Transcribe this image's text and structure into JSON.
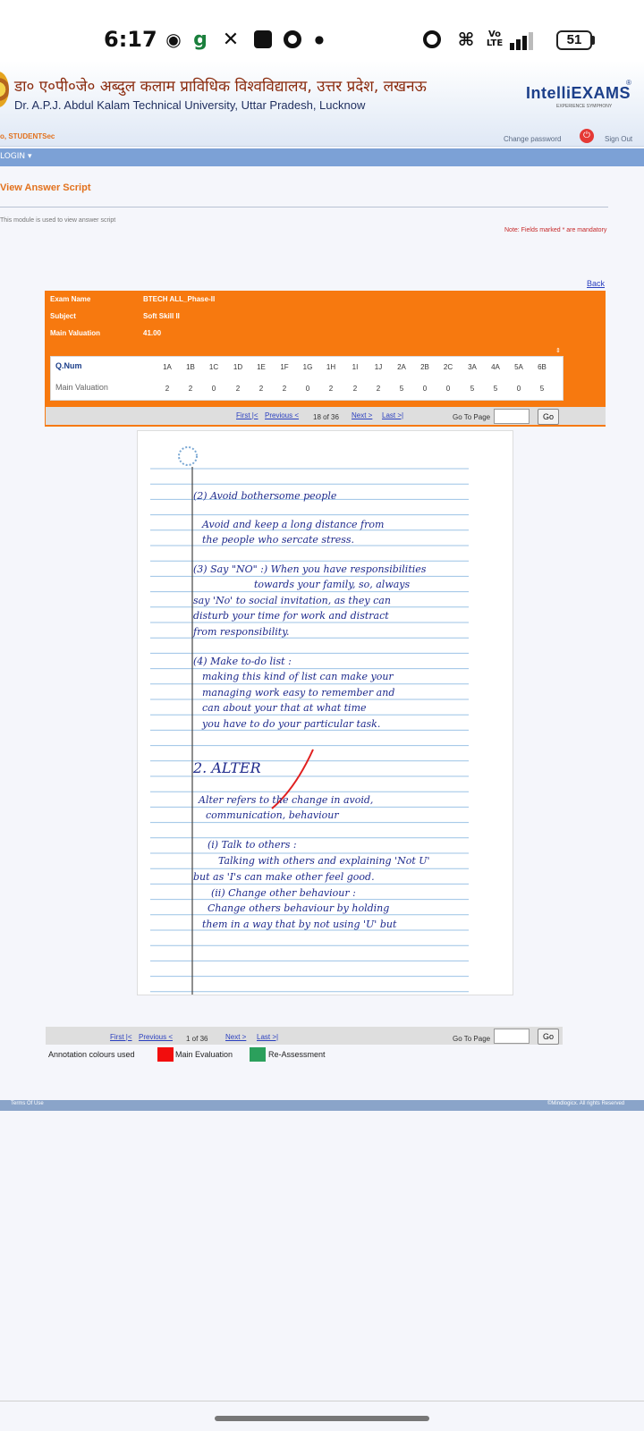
{
  "status": {
    "time": "6:17",
    "icons": [
      "chat-icon",
      "g-app-icon",
      "x-icon",
      "app-icon",
      "chrome-icon",
      "dot-icon",
      "alarm-icon",
      "wifi-icon",
      "volte-icon",
      "signal-icon"
    ],
    "volte_label": "Vo LTE",
    "battery": "51"
  },
  "header": {
    "hindi_title": "डा० ए०पी०जे० अब्दुल कलाम प्राविधिक विश्वविद्यालय, उत्तर प्रदेश, लखनऊ",
    "english_title": "Dr. A.P.J. Abdul Kalam Technical University, Uttar Pradesh, Lucknow",
    "brand": "IntelliEXAMS",
    "brand_tagline": "EXPERIENCE SYMPHONY",
    "registered": "®",
    "user_label": "o, STUDENTSec",
    "change_password": "Change password",
    "power_symbol": "⏻",
    "sign_out": "Sign Out"
  },
  "nav": {
    "login_menu": "LOGIN ▾"
  },
  "page": {
    "title": "View Answer Script",
    "description": "This module is used to view answer script",
    "mandatory_note": "Note: Fields marked * are mandatory",
    "back_link": "Back"
  },
  "exam": {
    "labels": [
      "Exam Name",
      "Subject",
      "Main Valuation"
    ],
    "values": [
      "BTECH ALL_Phase-II",
      "Soft Skill II",
      "41.00"
    ],
    "collapse_glyph": "⇕"
  },
  "marks": {
    "q_header": "Q.Num",
    "mv_header": "Main Valuation",
    "questions": [
      "1A",
      "1B",
      "1C",
      "1D",
      "1E",
      "1F",
      "1G",
      "1H",
      "1I",
      "1J",
      "2A",
      "2B",
      "2C",
      "3A",
      "4A",
      "5A",
      "6B"
    ],
    "values": [
      "2",
      "2",
      "0",
      "2",
      "2",
      "2",
      "0",
      "2",
      "2",
      "2",
      "5",
      "0",
      "0",
      "5",
      "5",
      "0",
      "5"
    ]
  },
  "pager_top": {
    "first": "First |<",
    "previous": "Previous <",
    "status": "18 of 36",
    "next": "Next >",
    "last": "Last >|",
    "go_to_label": "Go To Page",
    "go_button": "Go"
  },
  "pager_bottom": {
    "first": "First |<",
    "previous": "Previous <",
    "status": "1 of 36",
    "next": "Next >",
    "last": "Last >|",
    "go_to_label": "Go To Page",
    "go_button": "Go"
  },
  "script_lines": [
    "(2) Avoid bothersome people",
    "Avoid and keep a long distance from",
    "the people who sercate stress.",
    "(3) Say \"NO\" :) When you have responsibilities",
    "towards your family, so, always",
    "say 'No' to social invitation, as they can",
    "disturb your time for work and distract",
    "from responsibility.",
    "(4) Make to-do list :",
    "making this kind of list can make your",
    "managing work easy to remember and",
    "can about your that at what time",
    "you have to do your particular task.",
    "2. ALTER",
    "Alter refers to the change in avoid,",
    "communication, behaviour",
    "(i) Talk to others :",
    "Talking with others and explaining 'Not U'",
    "but as 'I's can make other feel good.",
    "(ii) Change other behaviour :",
    "Change others behaviour by holding",
    "them in a way that by not using 'U' but"
  ],
  "legend": {
    "label": "Annotation colours used",
    "main": "Main Evaluation",
    "reassess": "Re-Assessment",
    "main_color": "#f20d0d",
    "reassess_color": "#2ba05c"
  },
  "footer": {
    "terms": "Terms Of Use",
    "copyright": "©Mindlogicx. All rights Reserved"
  }
}
